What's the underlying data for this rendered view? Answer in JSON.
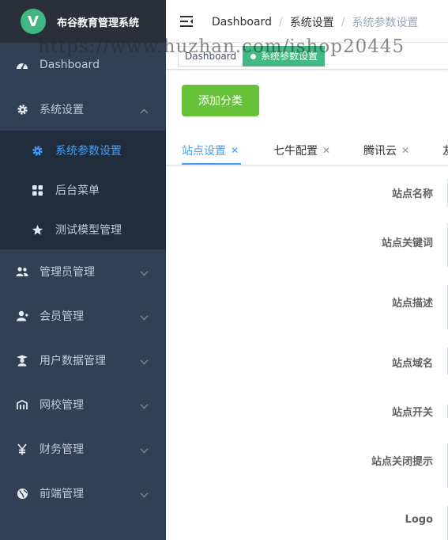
{
  "app": {
    "logo_letter": "V",
    "title": "布谷教育管理系统",
    "brand_color": "#41b883"
  },
  "sidebar": {
    "items": [
      {
        "label": "Dashboard",
        "icon": "dashboard-icon"
      },
      {
        "label": "系统设置",
        "icon": "gear-icon",
        "expanded": true
      },
      {
        "label": "管理员管理",
        "icon": "admins-icon"
      },
      {
        "label": "会员管理",
        "icon": "user-icon"
      },
      {
        "label": "用户数据管理",
        "icon": "graduate-icon"
      },
      {
        "label": "网校管理",
        "icon": "school-icon"
      },
      {
        "label": "财务管理",
        "icon": "yen-icon"
      },
      {
        "label": "前端管理",
        "icon": "globe-icon"
      }
    ],
    "submenu": [
      {
        "label": "系统参数设置",
        "icon": "gear-icon",
        "active": true
      },
      {
        "label": "后台菜单",
        "icon": "grid-icon"
      },
      {
        "label": "测试模型管理",
        "icon": "star-icon"
      }
    ]
  },
  "header": {
    "breadcrumb": [
      "Dashboard",
      "系统设置",
      "系统参数设置"
    ]
  },
  "tags_view": {
    "tags": [
      {
        "label": "Dashboard",
        "active": false
      },
      {
        "label": "系统参数设置",
        "active": true
      }
    ]
  },
  "watermark": "https://www.huzhan.com/ishop20445",
  "main": {
    "add_button": "添加分类",
    "tabs": [
      {
        "label": "站点设置",
        "active": true
      },
      {
        "label": "七牛配置",
        "active": false
      },
      {
        "label": "腾讯云",
        "active": false
      },
      {
        "label": "友",
        "active": false
      }
    ],
    "form_labels": [
      "站点名称",
      "站点关键词",
      "站点描述",
      "站点域名",
      "站点开关",
      "站点关闭提示",
      "Logo"
    ]
  },
  "colors": {
    "sidebar_bg": "#304156",
    "submenu_bg": "#1f2d3d",
    "active_blue": "#409eff",
    "success_green": "#67c23a"
  }
}
